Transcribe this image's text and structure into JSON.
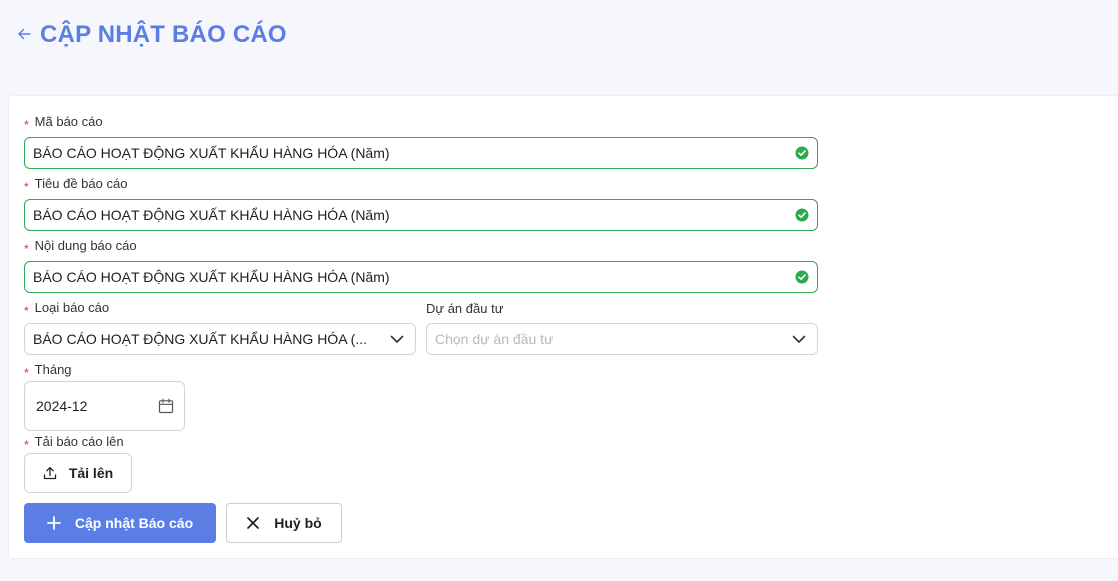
{
  "header": {
    "title": "CẬP NHẬT BÁO CÁO"
  },
  "form": {
    "report_code": {
      "label": "Mã báo cáo",
      "value": "BÁO CÁO HOẠT ĐỘNG XUẤT KHẨU HÀNG HÓA (Năm)"
    },
    "report_title": {
      "label": "Tiêu đề báo cáo",
      "value": "BÁO CÁO HOẠT ĐỘNG XUẤT KHẨU HÀNG HÓA (Năm)"
    },
    "report_content": {
      "label": "Nội dung báo cáo",
      "value": "BÁO CÁO HOẠT ĐỘNG XUẤT KHẨU HÀNG HÓA (Năm)"
    },
    "report_type": {
      "label": "Loại báo cáo",
      "value": "BÁO CÁO HOẠT ĐỘNG XUẤT KHẨU HÀNG HÓA (..."
    },
    "investment_project": {
      "label": "Dự án đầu tư",
      "placeholder": "Chọn dự án đầu tư"
    },
    "month": {
      "label": "Tháng",
      "value": "2024-12"
    },
    "upload": {
      "label": "Tải báo cáo lên",
      "button_label": "Tải lên"
    },
    "required_mark": "*"
  },
  "actions": {
    "submit_label": "Cập nhật Báo cáo",
    "cancel_label": "Huỷ bỏ"
  },
  "colors": {
    "accent": "#5b7ee5",
    "valid": "#2fa84f",
    "required": "#e03131"
  }
}
